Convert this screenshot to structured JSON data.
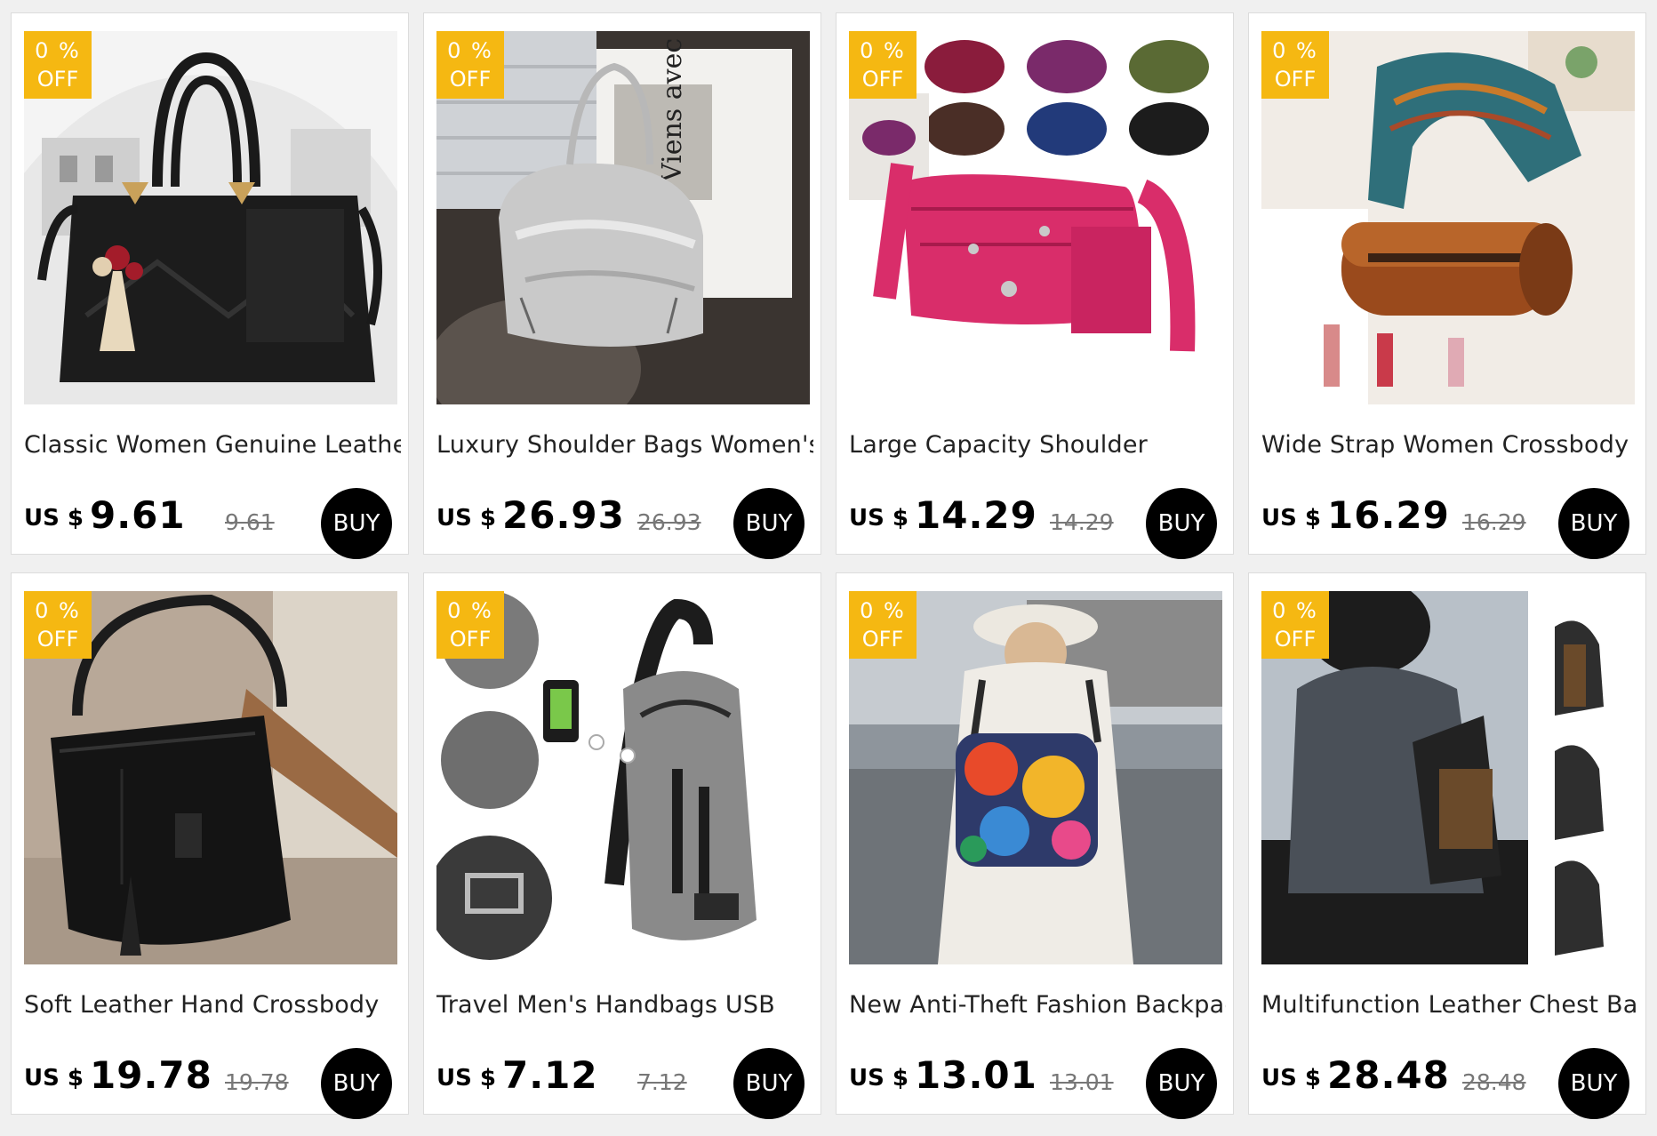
{
  "colors": {
    "badge": "#f5b812",
    "buy_button": "#000000",
    "background": "#f0f0f0"
  },
  "products": [
    {
      "discount": "0 %",
      "off": "OFF",
      "title": "Classic Women Genuine Leather",
      "currency": "US $",
      "price": "9.61",
      "original_price": "9.61",
      "buy_label": "BUY",
      "image": "black-handbag-image"
    },
    {
      "discount": "0 %",
      "off": "OFF",
      "title": "Luxury Shoulder Bags Women's",
      "currency": "US $",
      "price": "26.93",
      "original_price": "26.93",
      "buy_label": "BUY",
      "image": "silver-hobo-bag-image"
    },
    {
      "discount": "0 %",
      "off": "OFF",
      "title": "Large Capacity Shoulder",
      "currency": "US $",
      "price": "14.29",
      "original_price": "14.29",
      "buy_label": "BUY",
      "image": "pink-nylon-bag-image"
    },
    {
      "discount": "0 %",
      "off": "OFF",
      "title": "Wide Strap Women Crossbody",
      "currency": "US $",
      "price": "16.29",
      "original_price": "16.29",
      "buy_label": "BUY",
      "image": "brown-barrel-bag-image"
    },
    {
      "discount": "0 %",
      "off": "OFF",
      "title": "Soft Leather Hand Crossbody",
      "currency": "US $",
      "price": "19.78",
      "original_price": "19.78",
      "buy_label": "BUY",
      "image": "black-bucket-bag-image"
    },
    {
      "discount": "0 %",
      "off": "OFF",
      "title": "Travel Men's Handbags USB",
      "currency": "US $",
      "price": "7.12",
      "original_price": "7.12",
      "buy_label": "BUY",
      "image": "grey-sling-bag-image"
    },
    {
      "discount": "0 %",
      "off": "OFF",
      "title": "New Anti-Theft Fashion Backpack",
      "currency": "US $",
      "price": "13.01",
      "original_price": "13.01",
      "buy_label": "BUY",
      "image": "colorful-backpack-image"
    },
    {
      "discount": "0 %",
      "off": "OFF",
      "title": "Multifunction Leather Chest Bag",
      "currency": "US $",
      "price": "28.48",
      "original_price": "28.48",
      "buy_label": "BUY",
      "image": "chest-bag-image"
    }
  ]
}
